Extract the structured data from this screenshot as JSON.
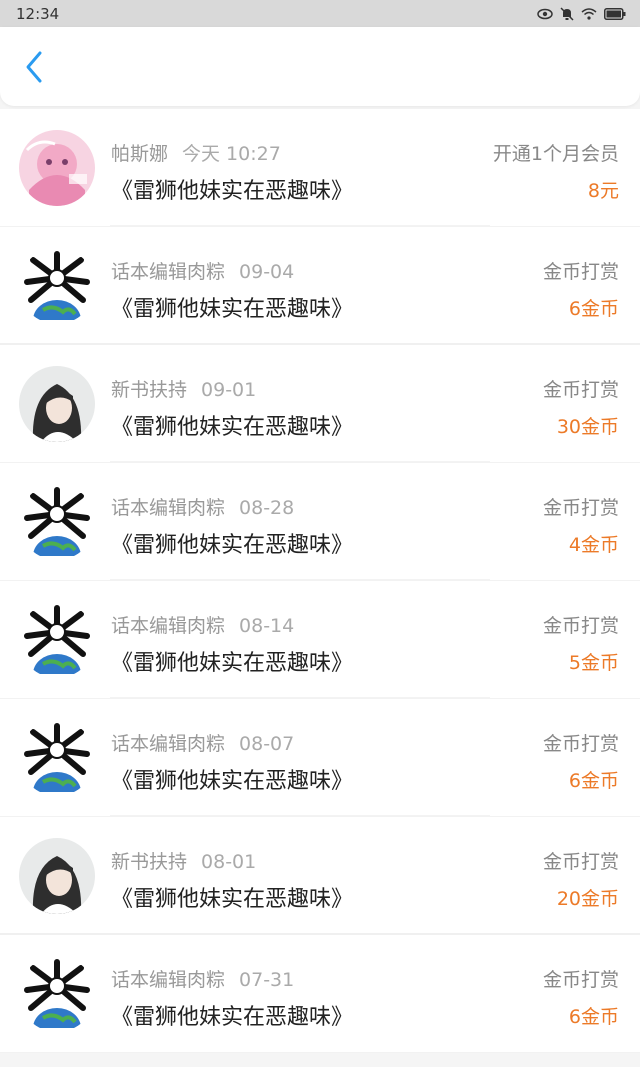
{
  "status_bar": {
    "time": "12:34"
  },
  "header": {
    "back_icon": "chevron-left-icon"
  },
  "colors": {
    "accent": "#2a9bf0",
    "amount": "#ec7a28",
    "meta": "#999999"
  },
  "records": [
    {
      "user": "帕斯娜",
      "date": "今天 10:27",
      "title": "《雷狮他妹实在恶趣味》",
      "type": "开通1个月会员",
      "amount": "8元",
      "avatar": "anime-pink"
    },
    {
      "user": "话本编辑肉粽",
      "date": "09-04",
      "title": "《雷狮他妹实在恶趣味》",
      "type": "金币打赏",
      "amount": "6金币",
      "avatar": "bones-globe"
    },
    {
      "user": "新书扶持",
      "date": "09-01",
      "title": "《雷狮他妹实在恶趣味》",
      "type": "金币打赏",
      "amount": "30金币",
      "avatar": "anime-portrait"
    },
    {
      "user": "话本编辑肉粽",
      "date": "08-28",
      "title": "《雷狮他妹实在恶趣味》",
      "type": "金币打赏",
      "amount": "4金币",
      "avatar": "bones-globe"
    },
    {
      "user": "话本编辑肉粽",
      "date": "08-14",
      "title": "《雷狮他妹实在恶趣味》",
      "type": "金币打赏",
      "amount": "5金币",
      "avatar": "bones-globe"
    },
    {
      "user": "话本编辑肉粽",
      "date": "08-07",
      "title": "《雷狮他妹实在恶趣味》",
      "type": "金币打赏",
      "amount": "6金币",
      "avatar": "bones-globe"
    },
    {
      "user": "新书扶持",
      "date": "08-01",
      "title": "《雷狮他妹实在恶趣味》",
      "type": "金币打赏",
      "amount": "20金币",
      "avatar": "anime-portrait"
    },
    {
      "user": "话本编辑肉粽",
      "date": "07-31",
      "title": "《雷狮他妹实在恶趣味》",
      "type": "金币打赏",
      "amount": "6金币",
      "avatar": "bones-globe"
    }
  ]
}
